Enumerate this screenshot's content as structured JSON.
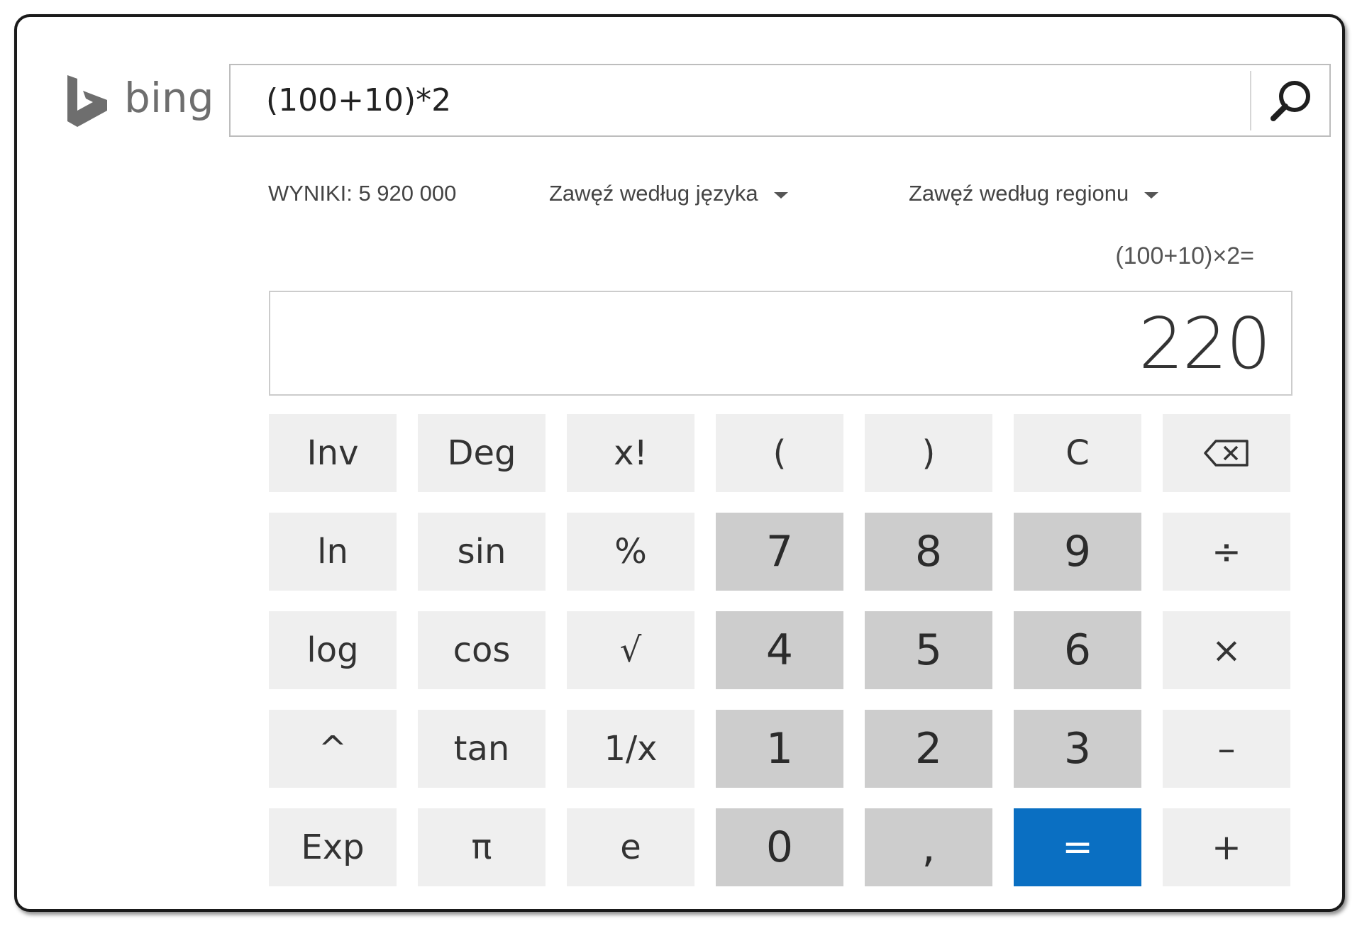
{
  "header": {
    "logo_text": "bing",
    "search_query": "(100+10)*2"
  },
  "filters": {
    "results_label": "WYNIKI: 5 920 000",
    "language_filter": "Zawęź według języka",
    "region_filter": "Zawęź według regionu"
  },
  "calculator": {
    "expression": "(100+10)×2=",
    "display_value": "220",
    "keys": {
      "inv": "Inv",
      "deg": "Deg",
      "fact": "x!",
      "lparen": "(",
      "rparen": ")",
      "clear": "C",
      "ln": "ln",
      "sin": "sin",
      "percent": "%",
      "seven": "7",
      "eight": "8",
      "nine": "9",
      "divide": "÷",
      "log": "log",
      "cos": "cos",
      "sqrt": "√",
      "four": "4",
      "five": "5",
      "six": "6",
      "multiply": "×",
      "power": "^",
      "tan": "tan",
      "reciprocal": "1/x",
      "one": "1",
      "two": "2",
      "three": "3",
      "minus": "–",
      "exp": "Exp",
      "pi": "π",
      "e": "e",
      "zero": "0",
      "comma": ",",
      "equals": "=",
      "plus": "+"
    }
  },
  "colors": {
    "equals_key": "#0a6fc2",
    "number_key": "#cdcdcd",
    "function_key": "#efefef"
  },
  "icons": {
    "search": "search-icon",
    "backspace": "backspace-icon",
    "logo": "bing-logo-icon"
  }
}
